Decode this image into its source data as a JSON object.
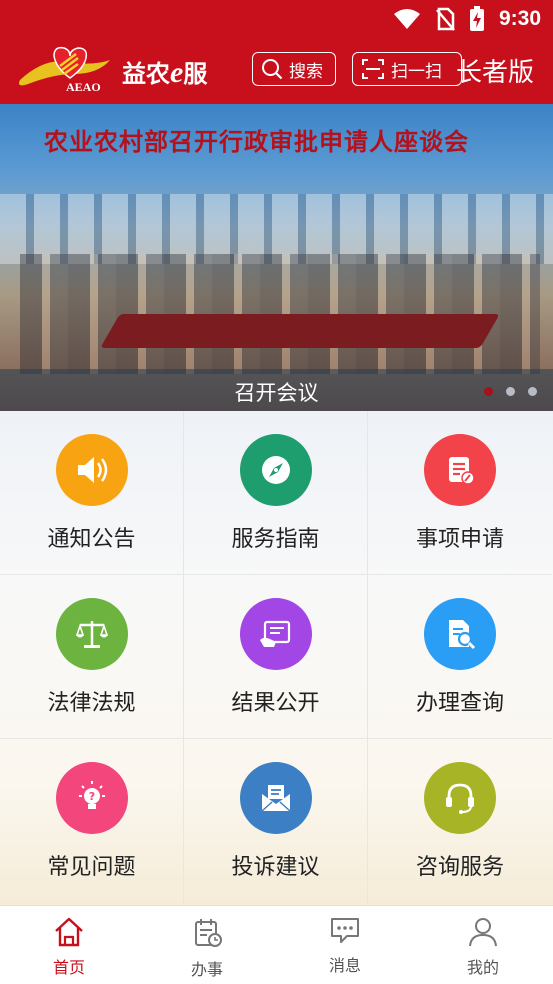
{
  "status_bar": {
    "time": "9:30"
  },
  "header": {
    "logo_text": "AEAO",
    "brand_prefix": "益农",
    "brand_e": "e",
    "brand_suffix": "服",
    "search_label": "搜索",
    "scan_label": "扫一扫",
    "elder_mode_label": "长者版"
  },
  "banner": {
    "headline": "农业农村部召开行政审批申请人座谈会",
    "caption": "召开会议",
    "slide_count": 3,
    "active_slide": 1
  },
  "grid": {
    "items": [
      {
        "label": "通知公告",
        "icon": "speaker-icon",
        "color": "#f8a412"
      },
      {
        "label": "服务指南",
        "icon": "compass-icon",
        "color": "#1e9e6e"
      },
      {
        "label": "事项申请",
        "icon": "document-edit-icon",
        "color": "#f2434a"
      },
      {
        "label": "法律法规",
        "icon": "scales-icon",
        "color": "#6cb33f"
      },
      {
        "label": "结果公开",
        "icon": "screen-hand-icon",
        "color": "#a246e6"
      },
      {
        "label": "办理查询",
        "icon": "document-search-icon",
        "color": "#2a9df4"
      },
      {
        "label": "常见问题",
        "icon": "lightbulb-question-icon",
        "color": "#f2467c"
      },
      {
        "label": "投诉建议",
        "icon": "envelope-icon",
        "color": "#3d7fc4"
      },
      {
        "label": "咨询服务",
        "icon": "headset-icon",
        "color": "#a6b425"
      }
    ]
  },
  "bottom_nav": {
    "items": [
      {
        "label": "首页",
        "icon": "home-icon",
        "active": true
      },
      {
        "label": "办事",
        "icon": "calendar-clock-icon",
        "active": false
      },
      {
        "label": "消息",
        "icon": "chat-bubble-icon",
        "active": false
      },
      {
        "label": "我的",
        "icon": "user-icon",
        "active": false
      }
    ]
  },
  "colors": {
    "brand_red": "#c8101c",
    "active_nav": "#c8101c"
  }
}
